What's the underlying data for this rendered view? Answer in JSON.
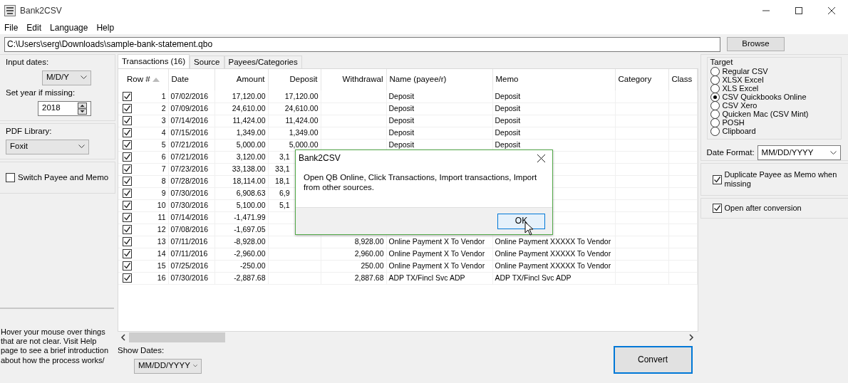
{
  "window": {
    "title": "Bank2CSV"
  },
  "menu": [
    "File",
    "Edit",
    "Language",
    "Help"
  ],
  "file_path": {
    "value": "C:\\Users\\serg\\Downloads\\sample-bank-statement.qbo"
  },
  "browse_button": "Browse",
  "options": {
    "input_dates_label": "Input dates:",
    "input_dates": "M/D/Y",
    "year_label": "Set year if missing:",
    "year": "2018",
    "pdf_label": "PDF Library:",
    "pdf_library": "Foxit",
    "switch_payee": {
      "label": "Switch Payee and Memo",
      "checked": false
    },
    "help_text": "Hover your mouse over things that are not clear. Visit Help page to see a brief introduction about how the process works/"
  },
  "tabs": [
    {
      "label": "Transactions (16)",
      "selected": true
    },
    {
      "label": "Source",
      "selected": false
    },
    {
      "label": "Payees/Categories",
      "selected": false
    }
  ],
  "table": {
    "columns": [
      {
        "label": "Row #",
        "sorted": true
      },
      {
        "label": "Date",
        "sorted": false
      },
      {
        "label": "Amount",
        "sorted": false
      },
      {
        "label": "Deposit",
        "sorted": false
      },
      {
        "label": "Withdrawal",
        "sorted": false
      },
      {
        "label": "Name (payee/r)",
        "sorted": false
      },
      {
        "label": "Memo",
        "sorted": false
      },
      {
        "label": "Category",
        "sorted": false
      },
      {
        "label": "Class",
        "sorted": false
      }
    ],
    "rows": [
      {
        "checked": true,
        "clipped": false,
        "cells": [
          "1",
          "07/02/2016",
          "17,120.00",
          "17,120.00",
          null,
          "Deposit",
          "Deposit"
        ]
      },
      {
        "checked": true,
        "clipped": false,
        "cells": [
          "2",
          "07/09/2016",
          "24,610.00",
          "24,610.00",
          null,
          "Deposit",
          "Deposit"
        ]
      },
      {
        "checked": true,
        "clipped": false,
        "cells": [
          "3",
          "07/14/2016",
          "11,424.00",
          "11,424.00",
          null,
          "Deposit",
          "Deposit"
        ]
      },
      {
        "checked": true,
        "clipped": false,
        "cells": [
          "4",
          "07/15/2016",
          "1,349.00",
          "1,349.00",
          null,
          "Deposit",
          "Deposit"
        ]
      },
      {
        "checked": true,
        "clipped": false,
        "cells": [
          "5",
          "07/21/2016",
          "5,000.00",
          "5,000.00",
          null,
          "Deposit",
          "Deposit"
        ]
      },
      {
        "checked": true,
        "clipped": true,
        "cells": [
          "6",
          "07/21/2016",
          "3,120.00",
          "3,1"
        ]
      },
      {
        "checked": true,
        "clipped": true,
        "cells": [
          "7",
          "07/23/2016",
          "33,138.00",
          "33,1"
        ]
      },
      {
        "checked": true,
        "clipped": true,
        "cells": [
          "8",
          "07/28/2016",
          "18,114.00",
          "18,1"
        ]
      },
      {
        "checked": true,
        "clipped": true,
        "cells": [
          "9",
          "07/30/2016",
          "6,908.63",
          "6,9"
        ]
      },
      {
        "checked": true,
        "clipped": true,
        "cells": [
          "10",
          "07/30/2016",
          "5,100.00",
          "5,1"
        ]
      },
      {
        "checked": true,
        "cells": [
          "11",
          "07/14/2016",
          "-1,471.99"
        ]
      },
      {
        "checked": true,
        "cells": [
          "12",
          "07/08/2016",
          "-1,697.05"
        ]
      },
      {
        "checked": true,
        "cells": [
          "13",
          "07/11/2016",
          "-8,928.00",
          null,
          "8,928.00",
          "Online Payment X To Vendor",
          "Online Payment XXXXX To Vendor"
        ]
      },
      {
        "checked": true,
        "cells": [
          "14",
          "07/11/2016",
          "-2,960.00",
          null,
          "2,960.00",
          "Online Payment X To Vendor",
          "Online Payment XXXXX To Vendor"
        ]
      },
      {
        "checked": true,
        "cells": [
          "15",
          "07/25/2016",
          "-250.00",
          null,
          "250.00",
          "Online Payment X To Vendor",
          "Online Payment XXXXX To Vendor"
        ]
      },
      {
        "checked": true,
        "cells": [
          "16",
          "07/30/2016",
          "-2,887.68",
          null,
          "2,887.68",
          "ADP TX/Fincl Svc ADP",
          "ADP TX/Fincl Svc ADP"
        ]
      }
    ]
  },
  "show_dates": {
    "label": "Show Dates:",
    "value": "MM/DD/YYYY"
  },
  "target": {
    "title": "Target",
    "options": [
      {
        "label": "Regular CSV",
        "selected": false
      },
      {
        "label": "XLSX Excel",
        "selected": false
      },
      {
        "label": "XLS Excel",
        "selected": false
      },
      {
        "label": "CSV Quickbooks Online",
        "selected": true
      },
      {
        "label": "CSV Xero",
        "selected": false
      },
      {
        "label": "Quicken Mac (CSV Mint)",
        "selected": false
      },
      {
        "label": "POSH",
        "selected": false
      },
      {
        "label": "Clipboard",
        "selected": false
      }
    ]
  },
  "date_format": {
    "label": "Date Format:",
    "value": "MM/DD/YYYY"
  },
  "duplicate_payee": {
    "label": "Duplicate Payee as Memo when missing",
    "checked": true
  },
  "open_after": {
    "label": "Open after conversion",
    "checked": true
  },
  "convert_button": "Convert",
  "dialog": {
    "title": "Bank2CSV",
    "message": "Open QB Online, Click Transactions, Import transactions, Import from other sources.",
    "button": "OK"
  }
}
